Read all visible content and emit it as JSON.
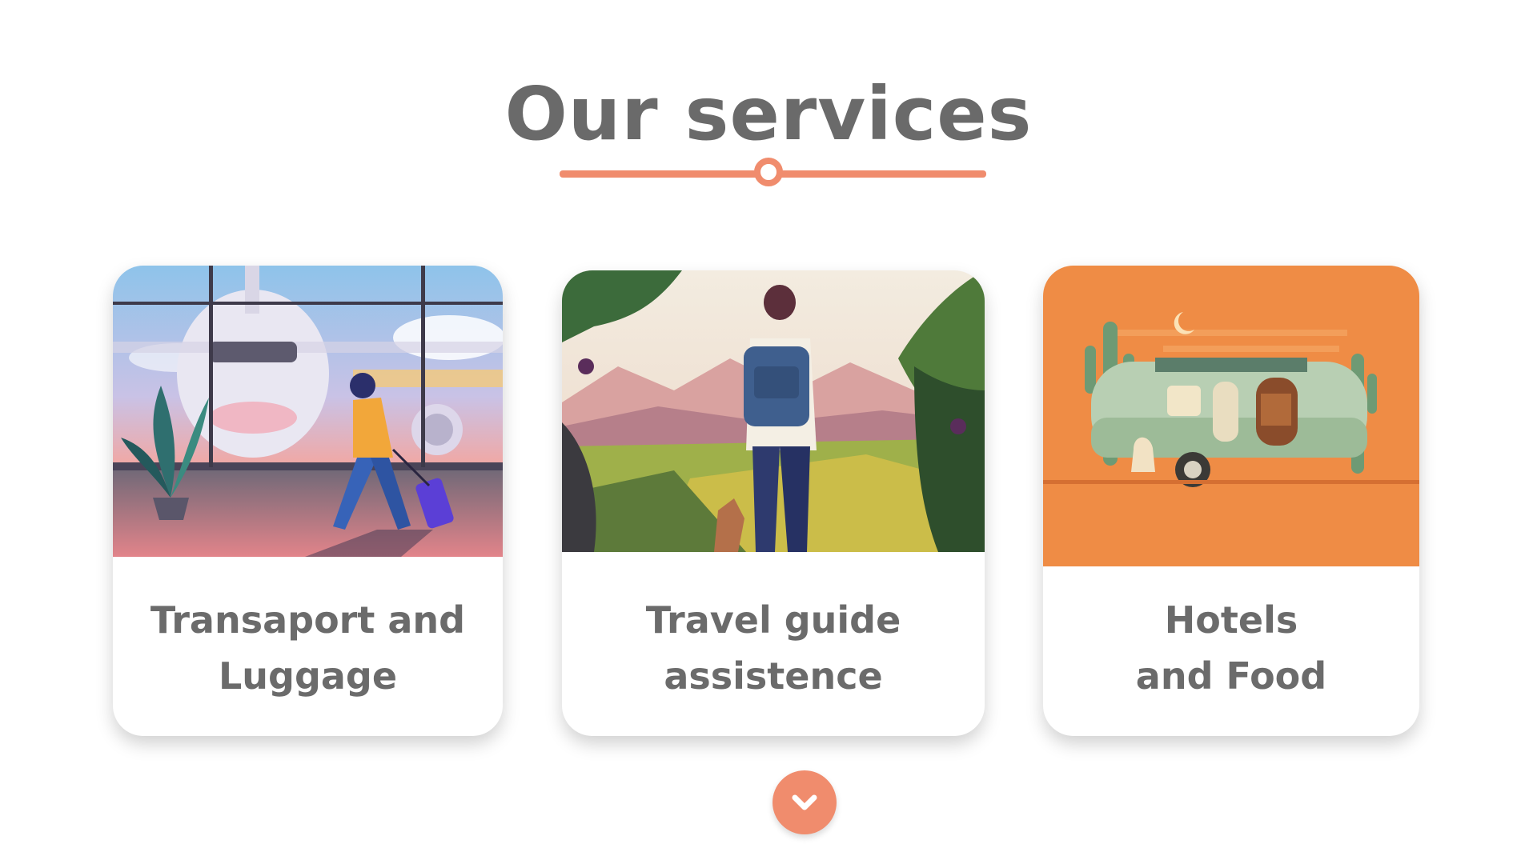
{
  "section": {
    "title": "Our services"
  },
  "accent_color": "#f08c6d",
  "cards": [
    {
      "label_line1": "Transaport and",
      "label_line2": "Luggage",
      "image": "airport-traveler-illustration"
    },
    {
      "label_line1": "Travel guide",
      "label_line2": "assistence",
      "image": "hiker-landscape-illustration"
    },
    {
      "label_line1": "Hotels",
      "label_line2": "and Food",
      "image": "camper-trailer-desert-illustration"
    }
  ],
  "scroll_button": {
    "icon": "chevron-down-icon"
  }
}
